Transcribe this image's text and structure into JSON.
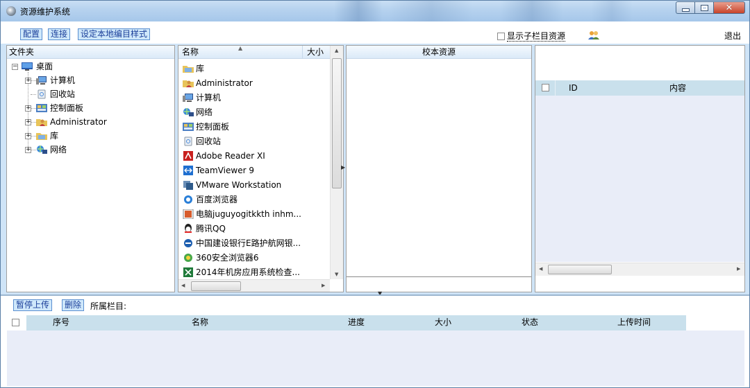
{
  "window": {
    "title": "资源维护系统"
  },
  "toolbar": {
    "config_label": "配置",
    "connect_label": "连接",
    "local_style_label": "设定本地编目样式",
    "show_sub_label": "显示子栏目资源",
    "exit_label": "退出"
  },
  "folders_panel": {
    "header": "文件夹",
    "tree": [
      "桌面",
      "计算机",
      "回收站",
      "控制面板",
      "Administrator",
      "库",
      "网络"
    ]
  },
  "files_panel": {
    "col_name": "名称",
    "col_size": "大小",
    "items": [
      "库",
      "Administrator",
      "计算机",
      "网络",
      "控制面板",
      "回收站",
      "Adobe Reader XI",
      "TeamViewer 9",
      "VMware Workstation",
      "百度浏览器",
      "电脑juguyogitkkth inhm...",
      "腾讯QQ",
      "中国建设银行E路护航网银...",
      "360安全浏览器6",
      "2014年机房应用系统检查..."
    ]
  },
  "proof_panel": {
    "header": "校本资源"
  },
  "content_panel": {
    "col_id": "ID",
    "col_content": "内容"
  },
  "upload": {
    "pause_label": "暂停上传",
    "delete_label": "删除",
    "category_label": "所属栏目:",
    "columns": [
      "序号",
      "名称",
      "进度",
      "大小",
      "状态",
      "上传时间"
    ]
  }
}
